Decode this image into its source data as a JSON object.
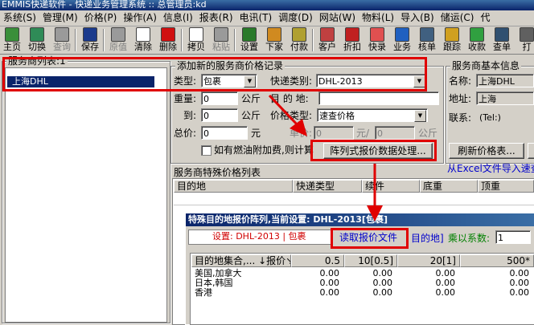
{
  "title": "EMMIS快递软件 - 快递业务管理系统 :: 总管理员:kd",
  "menu": [
    "系统(S)",
    "管理(M)",
    "价格(P)",
    "操作(A)",
    "信息(I)",
    "报表(R)",
    "电讯(T)",
    "调度(D)",
    "网站(W)",
    "物料(L)",
    "导入(B)",
    "储运(C)",
    "代"
  ],
  "toolbar": [
    {
      "label": "主页",
      "icon": "home-icon",
      "color": "#3a8f3a",
      "disabled": false
    },
    {
      "label": "切换",
      "icon": "switch-icon",
      "color": "#2f8b57",
      "disabled": false
    },
    {
      "label": "查询",
      "icon": "binoculars-icon",
      "color": "#9a9a9a",
      "disabled": true
    },
    {
      "label": "保存",
      "icon": "save-icon",
      "color": "#1a3a8c",
      "disabled": false
    },
    {
      "label": "原值",
      "icon": "undo-icon",
      "color": "#9a9a9a",
      "disabled": true
    },
    {
      "label": "清除",
      "icon": "clear-icon",
      "color": "#ffffff",
      "disabled": false
    },
    {
      "label": "删除",
      "icon": "delete-icon",
      "color": "#d01010",
      "disabled": false
    },
    {
      "label": "拷贝",
      "icon": "copy-icon",
      "color": "#ffffff",
      "disabled": false
    },
    {
      "label": "粘贴",
      "icon": "paste-icon",
      "color": "#9a9a9a",
      "disabled": true
    },
    {
      "label": "设置",
      "icon": "settings-icon",
      "color": "#2a7a2a",
      "disabled": false
    },
    {
      "label": "下家",
      "icon": "next-agent-icon",
      "color": "#d08a20",
      "disabled": false
    },
    {
      "label": "付款",
      "icon": "payment-icon",
      "color": "#b0a030",
      "disabled": false
    },
    {
      "label": "客户",
      "icon": "customer-icon",
      "color": "#c04040",
      "disabled": false
    },
    {
      "label": "折扣",
      "icon": "discount-icon",
      "color": "#c02020",
      "disabled": false
    },
    {
      "label": "快录",
      "icon": "quick-entry-icon",
      "color": "#e05050",
      "disabled": false
    },
    {
      "label": "业务",
      "icon": "business-icon",
      "color": "#2060c0",
      "disabled": false
    },
    {
      "label": "核单",
      "icon": "verify-icon",
      "color": "#406080",
      "disabled": false
    },
    {
      "label": "跟踪",
      "icon": "track-icon",
      "color": "#d0a020",
      "disabled": false
    },
    {
      "label": "收款",
      "icon": "receive-icon",
      "color": "#30a040",
      "disabled": false
    },
    {
      "label": "查单",
      "icon": "search-order-icon",
      "color": "#305070",
      "disabled": false
    },
    {
      "label": "打",
      "icon": "print-icon",
      "color": "#606060",
      "disabled": false
    }
  ],
  "provider_list": {
    "legend": "服务商列表:1",
    "items": [
      "上海DHL"
    ]
  },
  "add_price": {
    "legend": "添加新的服务商价格记录",
    "type_label": "类型:",
    "type_value": "包裹",
    "express_label": "快递类别:",
    "express_value": "DHL-2013",
    "weight_label": "重量:",
    "weight_value": "0",
    "kg_label": "公斤",
    "dest_label": "目 的 地:",
    "dest_value": "",
    "to_label": "到:",
    "to_value": "0",
    "kg_label2": "公斤",
    "price_type_label": "价格类型:",
    "price_type_value": "速查价格",
    "total_label": "总价:",
    "total_value": "0",
    "yuan_label": "元",
    "unit_label": "单价:",
    "unit_value": "0",
    "per_label": "元/",
    "unit_weight": "0",
    "kg_label3": "公斤",
    "fuel_label": "如有燃油附加费,则计算",
    "matrix_button": "阵列式报价数据处理..."
  },
  "provider_info": {
    "legend": "服务商基本信息",
    "name_label": "名称:",
    "name_value": "上海DHL",
    "addr_label": "地址:",
    "addr_value": "上海",
    "contact_label": "联系:",
    "contact_value": "(Tel:)",
    "refresh_button": "刷新价格表...",
    "excel_link": "从Excel文件导入速查"
  },
  "special_prices": {
    "legend": "服务商特殊价格列表",
    "columns": [
      "目的地",
      "快递类型",
      "续件",
      "底重",
      "顶重"
    ]
  },
  "matrix_dialog": {
    "title": "特殊目的地报价阵列,当前设置: DHL-2013[包裹]",
    "setting_text": "设置: DHL-2013 | 包裹",
    "read_button": "读取报价文件",
    "dest_link": "目的地]",
    "multiplier_label": "乘以系数:",
    "multiplier_value": "1",
    "columns": [
      "目的地集合,... ↓报价↘",
      "0.5",
      "10[0.5]",
      "20[1]",
      "500*"
    ],
    "rows": [
      {
        "name": "美国,加拿大",
        "values": [
          "0.00",
          "0.00",
          "0.00",
          "0.00"
        ]
      },
      {
        "name": "日本,韩国",
        "values": [
          "0.00",
          "0.00",
          "0.00",
          "0.00"
        ]
      },
      {
        "name": "香港",
        "values": [
          "0.00",
          "0.00",
          "0.00",
          "0.00"
        ]
      }
    ]
  }
}
